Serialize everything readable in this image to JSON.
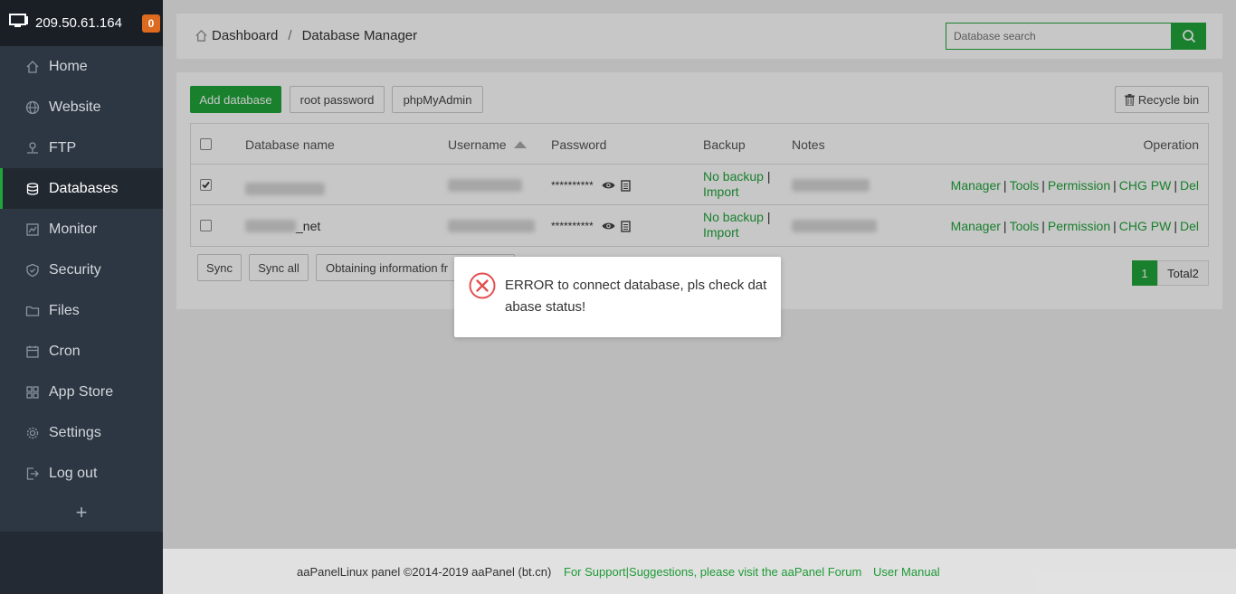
{
  "sidebar": {
    "ip": "209.50.61.164",
    "badge": "0",
    "items": [
      {
        "label": "Home",
        "icon": "home-icon"
      },
      {
        "label": "Website",
        "icon": "globe-icon"
      },
      {
        "label": "FTP",
        "icon": "ftp-icon"
      },
      {
        "label": "Databases",
        "icon": "database-icon",
        "active": true
      },
      {
        "label": "Monitor",
        "icon": "monitor-icon"
      },
      {
        "label": "Security",
        "icon": "shield-icon"
      },
      {
        "label": "Files",
        "icon": "folder-icon"
      },
      {
        "label": "Cron",
        "icon": "calendar-icon"
      },
      {
        "label": "App Store",
        "icon": "grid-icon"
      },
      {
        "label": "Settings",
        "icon": "gear-icon"
      },
      {
        "label": "Log out",
        "icon": "logout-icon"
      }
    ],
    "add": "+"
  },
  "header": {
    "crumb_home": "Dashboard",
    "crumb_sep": "/",
    "crumb_current": "Database Manager",
    "search_placeholder": "Database search"
  },
  "toolbar": {
    "add_database": "Add database",
    "root_password": "root password",
    "phpmyadmin": "phpMyAdmin",
    "recycle_bin": "Recycle bin"
  },
  "table": {
    "headers": {
      "name": "Database name",
      "username": "Username",
      "password": "Password",
      "backup": "Backup",
      "notes": "Notes",
      "operation": "Operation"
    },
    "rows": [
      {
        "checked": true,
        "name_suffix": "",
        "password": "**********",
        "backup_none": "No backup",
        "backup_sep": "|",
        "import": "Import"
      },
      {
        "checked": false,
        "name_suffix": "_net",
        "password": "**********",
        "backup_none": "No backup",
        "backup_sep": "|",
        "import": "Import"
      }
    ],
    "ops": {
      "manager": "Manager",
      "tools": "Tools",
      "permission": "Permission",
      "chgpw": "CHG PW",
      "del": "Del",
      "sep": "|"
    }
  },
  "bottom": {
    "sync": "Sync",
    "sync_all": "Sync all",
    "obtaining": "Obtaining information fr",
    "page_current": "1",
    "page_total": "Total2"
  },
  "dialog": {
    "message": "ERROR to connect database, pls check database status!"
  },
  "footer": {
    "copyright": "aaPanelLinux panel ©2014-2019 aaPanel (bt.cn)",
    "support": "For Support|Suggestions, please visit the aaPanel Forum",
    "manual": "User Manual"
  },
  "colors": {
    "accent": "#20a53a",
    "sidebar_bg": "#2d3743",
    "badge": "#dd6a1e",
    "error": "#e45050"
  }
}
